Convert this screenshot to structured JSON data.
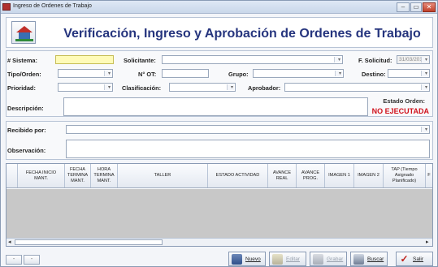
{
  "window": {
    "title": "Ingreso de Ordenes de Trabajo",
    "controls": [
      "–",
      "▭",
      "✕"
    ]
  },
  "header": {
    "title": "Verificación, Ingreso y Aprobación de Ordenes de Trabajo"
  },
  "form": {
    "sistema_label": "# Sistema:",
    "solicitante_label": "Solicitante:",
    "fecha_solicitud_label": "F. Solicitud:",
    "fecha_solicitud_value": "31/03/2017",
    "tipo_orden_label": "Tipo/Orden:",
    "not_label": "N° OT:",
    "grupo_label": "Grupo:",
    "destino_label": "Destino:",
    "prioridad_label": "Prioridad:",
    "clasificacion_label": "Clasificación:",
    "aprobador_label": "Aprobador:",
    "descripcion_label": "Descripción:",
    "estado_label": "Estado Orden:",
    "estado_value": "NO EJECUTADA",
    "recibido_label": "Recibido por:",
    "observacion_label": "Observación:"
  },
  "grid": {
    "columns": [
      "FECHA INICIO MANT.",
      "FECHA TERMINA MANT.",
      "HORA TERMINA MANT.",
      "TALLER",
      "ESTADO ACTIVIDAD",
      "AVANCE REAL",
      "AVANCE PROG.",
      "IMAGEN 1",
      "IMAGEN 2",
      "TAP (Tiempo Asignado Planificado)",
      "F"
    ]
  },
  "footer": {
    "prev_label": "-",
    "next_label": "-",
    "nuevo_label": "Nuevo",
    "editar_label": "Editar",
    "grabar_label": "Grabar",
    "buscar_label": "Buscar",
    "salir_label": "Salir"
  },
  "colors": {
    "title_blue": "#26357e",
    "status_red": "#d0111b",
    "required_yellow": "#fffbb8"
  }
}
